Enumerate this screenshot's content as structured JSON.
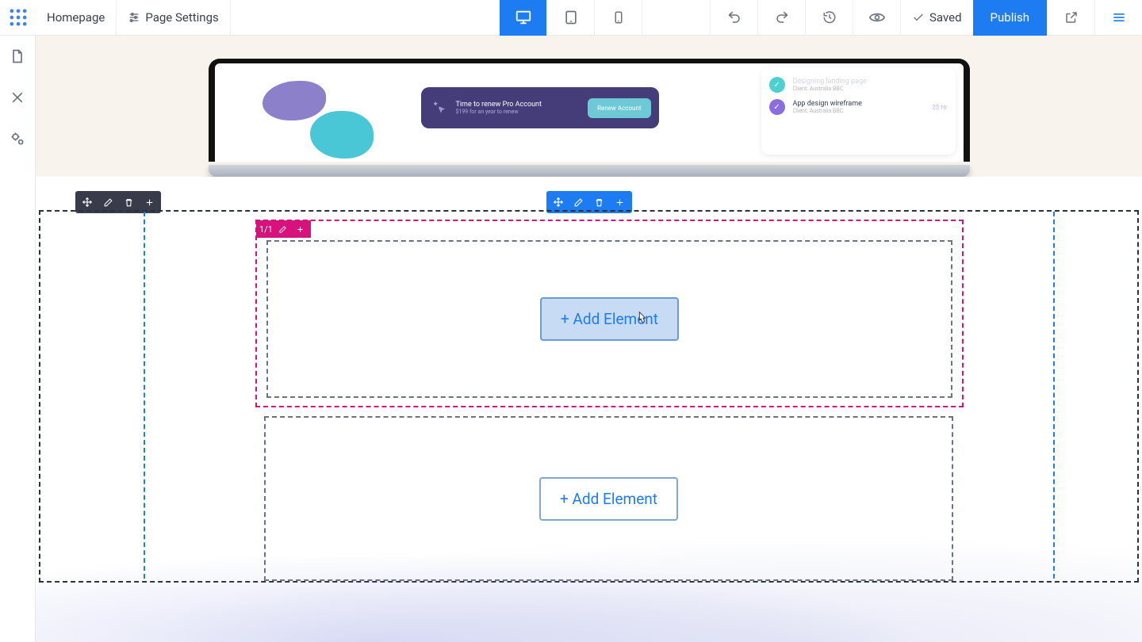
{
  "topbar": {
    "homepage_label": "Homepage",
    "page_settings_label": "Page Settings",
    "saved_label": "Saved",
    "publish_label": "Publish"
  },
  "mockup": {
    "renew_title": "Time to renew Pro Account",
    "renew_sub": "$199 for an year to renew",
    "renew_button": "Renew Account",
    "task1_title": "Designing landing page",
    "task1_sub": "Client: Australia BBC",
    "task2_title": "App design wireframe",
    "task2_sub": "Client: Australia BBC",
    "task2_meta": "23 Hr"
  },
  "column_badge": {
    "ratio": "1/1"
  },
  "buttons": {
    "add_element": "+ Add Element"
  }
}
